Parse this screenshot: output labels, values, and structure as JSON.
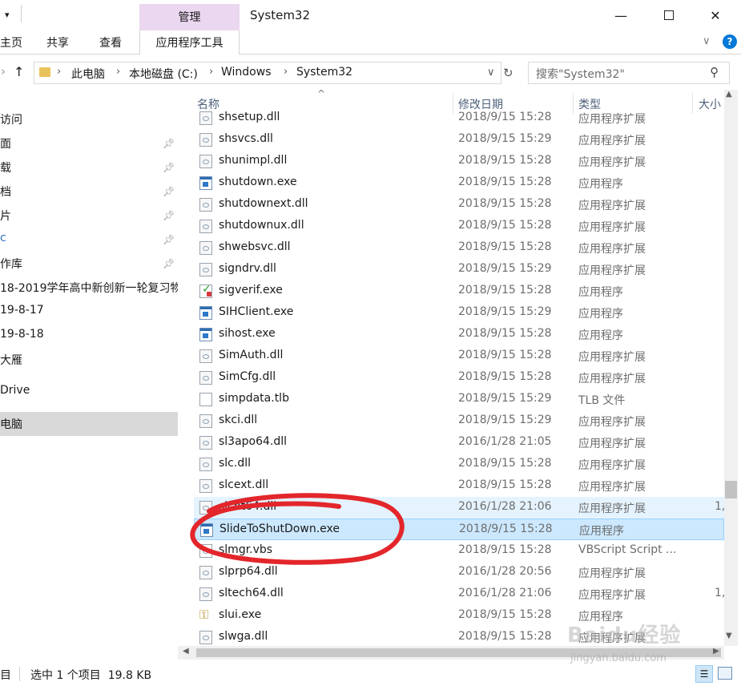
{
  "window": {
    "title": "System32",
    "context_group_label": "管理",
    "minimize_icon": "minimize-icon",
    "maximize_icon": "maximize-icon",
    "close_icon": "close-icon"
  },
  "ribbon": {
    "tabs": [
      "主页",
      "共享",
      "查看"
    ],
    "context_tab": "应用程序工具"
  },
  "address": {
    "path": [
      "此电脑",
      "本地磁盘 (C:)",
      "Windows",
      "System32"
    ],
    "search_placeholder": "搜索\"System32\""
  },
  "nav": {
    "items": [
      {
        "label": "访问",
        "pinned": false
      },
      {
        "label": "面",
        "pinned": true
      },
      {
        "label": "载",
        "pinned": true
      },
      {
        "label": "档",
        "pinned": true
      },
      {
        "label": "片",
        "pinned": true
      },
      {
        "label": "c",
        "pinned": true
      },
      {
        "label": "作库",
        "pinned": true
      },
      {
        "label": "18-2019学年高中新创新一轮复习物",
        "pinned": false
      },
      {
        "label": "19-8-17",
        "pinned": false
      },
      {
        "label": "19-8-18",
        "pinned": false
      },
      {
        "label": "大雁",
        "pinned": false
      },
      {
        "label": "Drive",
        "pinned": false
      },
      {
        "label": "电脑",
        "pinned": false
      }
    ]
  },
  "filelist": {
    "columns": {
      "name": "名称",
      "date": "修改日期",
      "type": "类型",
      "size": "大小"
    },
    "rows": [
      {
        "name": "shsetup.dll",
        "date": "2018/9/15 15:28",
        "type": "应用程序扩展",
        "size": "",
        "icon": "dll"
      },
      {
        "name": "shsvcs.dll",
        "date": "2018/9/15 15:29",
        "type": "应用程序扩展",
        "size": "",
        "icon": "dll"
      },
      {
        "name": "shunimpl.dll",
        "date": "2018/9/15 15:28",
        "type": "应用程序扩展",
        "size": "",
        "icon": "dll"
      },
      {
        "name": "shutdown.exe",
        "date": "2018/9/15 15:28",
        "type": "应用程序",
        "size": "",
        "icon": "exe"
      },
      {
        "name": "shutdownext.dll",
        "date": "2018/9/15 15:28",
        "type": "应用程序扩展",
        "size": "",
        "icon": "dll"
      },
      {
        "name": "shutdownux.dll",
        "date": "2018/9/15 15:28",
        "type": "应用程序扩展",
        "size": "",
        "icon": "dll"
      },
      {
        "name": "shwebsvc.dll",
        "date": "2018/9/15 15:28",
        "type": "应用程序扩展",
        "size": "",
        "icon": "dll"
      },
      {
        "name": "signdrv.dll",
        "date": "2018/9/15 15:29",
        "type": "应用程序扩展",
        "size": "",
        "icon": "dll"
      },
      {
        "name": "sigverif.exe",
        "date": "2018/9/15 15:28",
        "type": "应用程序",
        "size": "",
        "icon": "check"
      },
      {
        "name": "SIHClient.exe",
        "date": "2018/9/15 15:29",
        "type": "应用程序",
        "size": "",
        "icon": "exe"
      },
      {
        "name": "sihost.exe",
        "date": "2018/9/15 15:28",
        "type": "应用程序",
        "size": "",
        "icon": "exe"
      },
      {
        "name": "SimAuth.dll",
        "date": "2018/9/15 15:28",
        "type": "应用程序扩展",
        "size": "",
        "icon": "dll"
      },
      {
        "name": "SimCfg.dll",
        "date": "2018/9/15 15:28",
        "type": "应用程序扩展",
        "size": "",
        "icon": "dll"
      },
      {
        "name": "simpdata.tlb",
        "date": "2018/9/15 15:29",
        "type": "TLB 文件",
        "size": "",
        "icon": "file"
      },
      {
        "name": "skci.dll",
        "date": "2018/9/15 15:29",
        "type": "应用程序扩展",
        "size": "",
        "icon": "dll"
      },
      {
        "name": "sl3apo64.dll",
        "date": "2016/1/28 21:05",
        "type": "应用程序扩展",
        "size": "",
        "icon": "dll"
      },
      {
        "name": "slc.dll",
        "date": "2018/9/15 15:28",
        "type": "应用程序扩展",
        "size": "",
        "icon": "dll"
      },
      {
        "name": "slcext.dll",
        "date": "2018/9/15 15:28",
        "type": "应用程序扩展",
        "size": "",
        "icon": "dll"
      },
      {
        "name": "slcnt64.dll",
        "date": "2016/1/28 21:06",
        "type": "应用程序扩展",
        "size": "1,",
        "icon": "dll",
        "state": "hover"
      },
      {
        "name": "SlideToShutDown.exe",
        "date": "2018/9/15 15:28",
        "type": "应用程序",
        "size": "",
        "icon": "exe",
        "state": "selected"
      },
      {
        "name": "slmgr.vbs",
        "date": "2018/9/15 15:28",
        "type": "VBScript Script ...",
        "size": "",
        "icon": "vbs"
      },
      {
        "name": "slprp64.dll",
        "date": "2016/1/28 20:56",
        "type": "应用程序扩展",
        "size": "",
        "icon": "dll"
      },
      {
        "name": "sltech64.dll",
        "date": "2016/1/28 21:06",
        "type": "应用程序扩展",
        "size": "1,",
        "icon": "dll"
      },
      {
        "name": "slui.exe",
        "date": "2018/9/15 15:28",
        "type": "应用程序",
        "size": "",
        "icon": "key"
      },
      {
        "name": "slwga.dll",
        "date": "2018/9/15 15:28",
        "type": "应用程序扩展",
        "size": "",
        "icon": "dll"
      }
    ]
  },
  "status": {
    "count": "目",
    "selection": "选中 1 个项目  19.8 KB"
  },
  "watermark": {
    "line1": "Baidu经验",
    "line2": "jingyan.baidu.com"
  },
  "colors": {
    "accent": "#0078d7",
    "context_tab": "#ebd7f0",
    "selected_row": "#cce8ff",
    "hover_row": "#e5f3ff",
    "annotation": "#e3262b"
  }
}
